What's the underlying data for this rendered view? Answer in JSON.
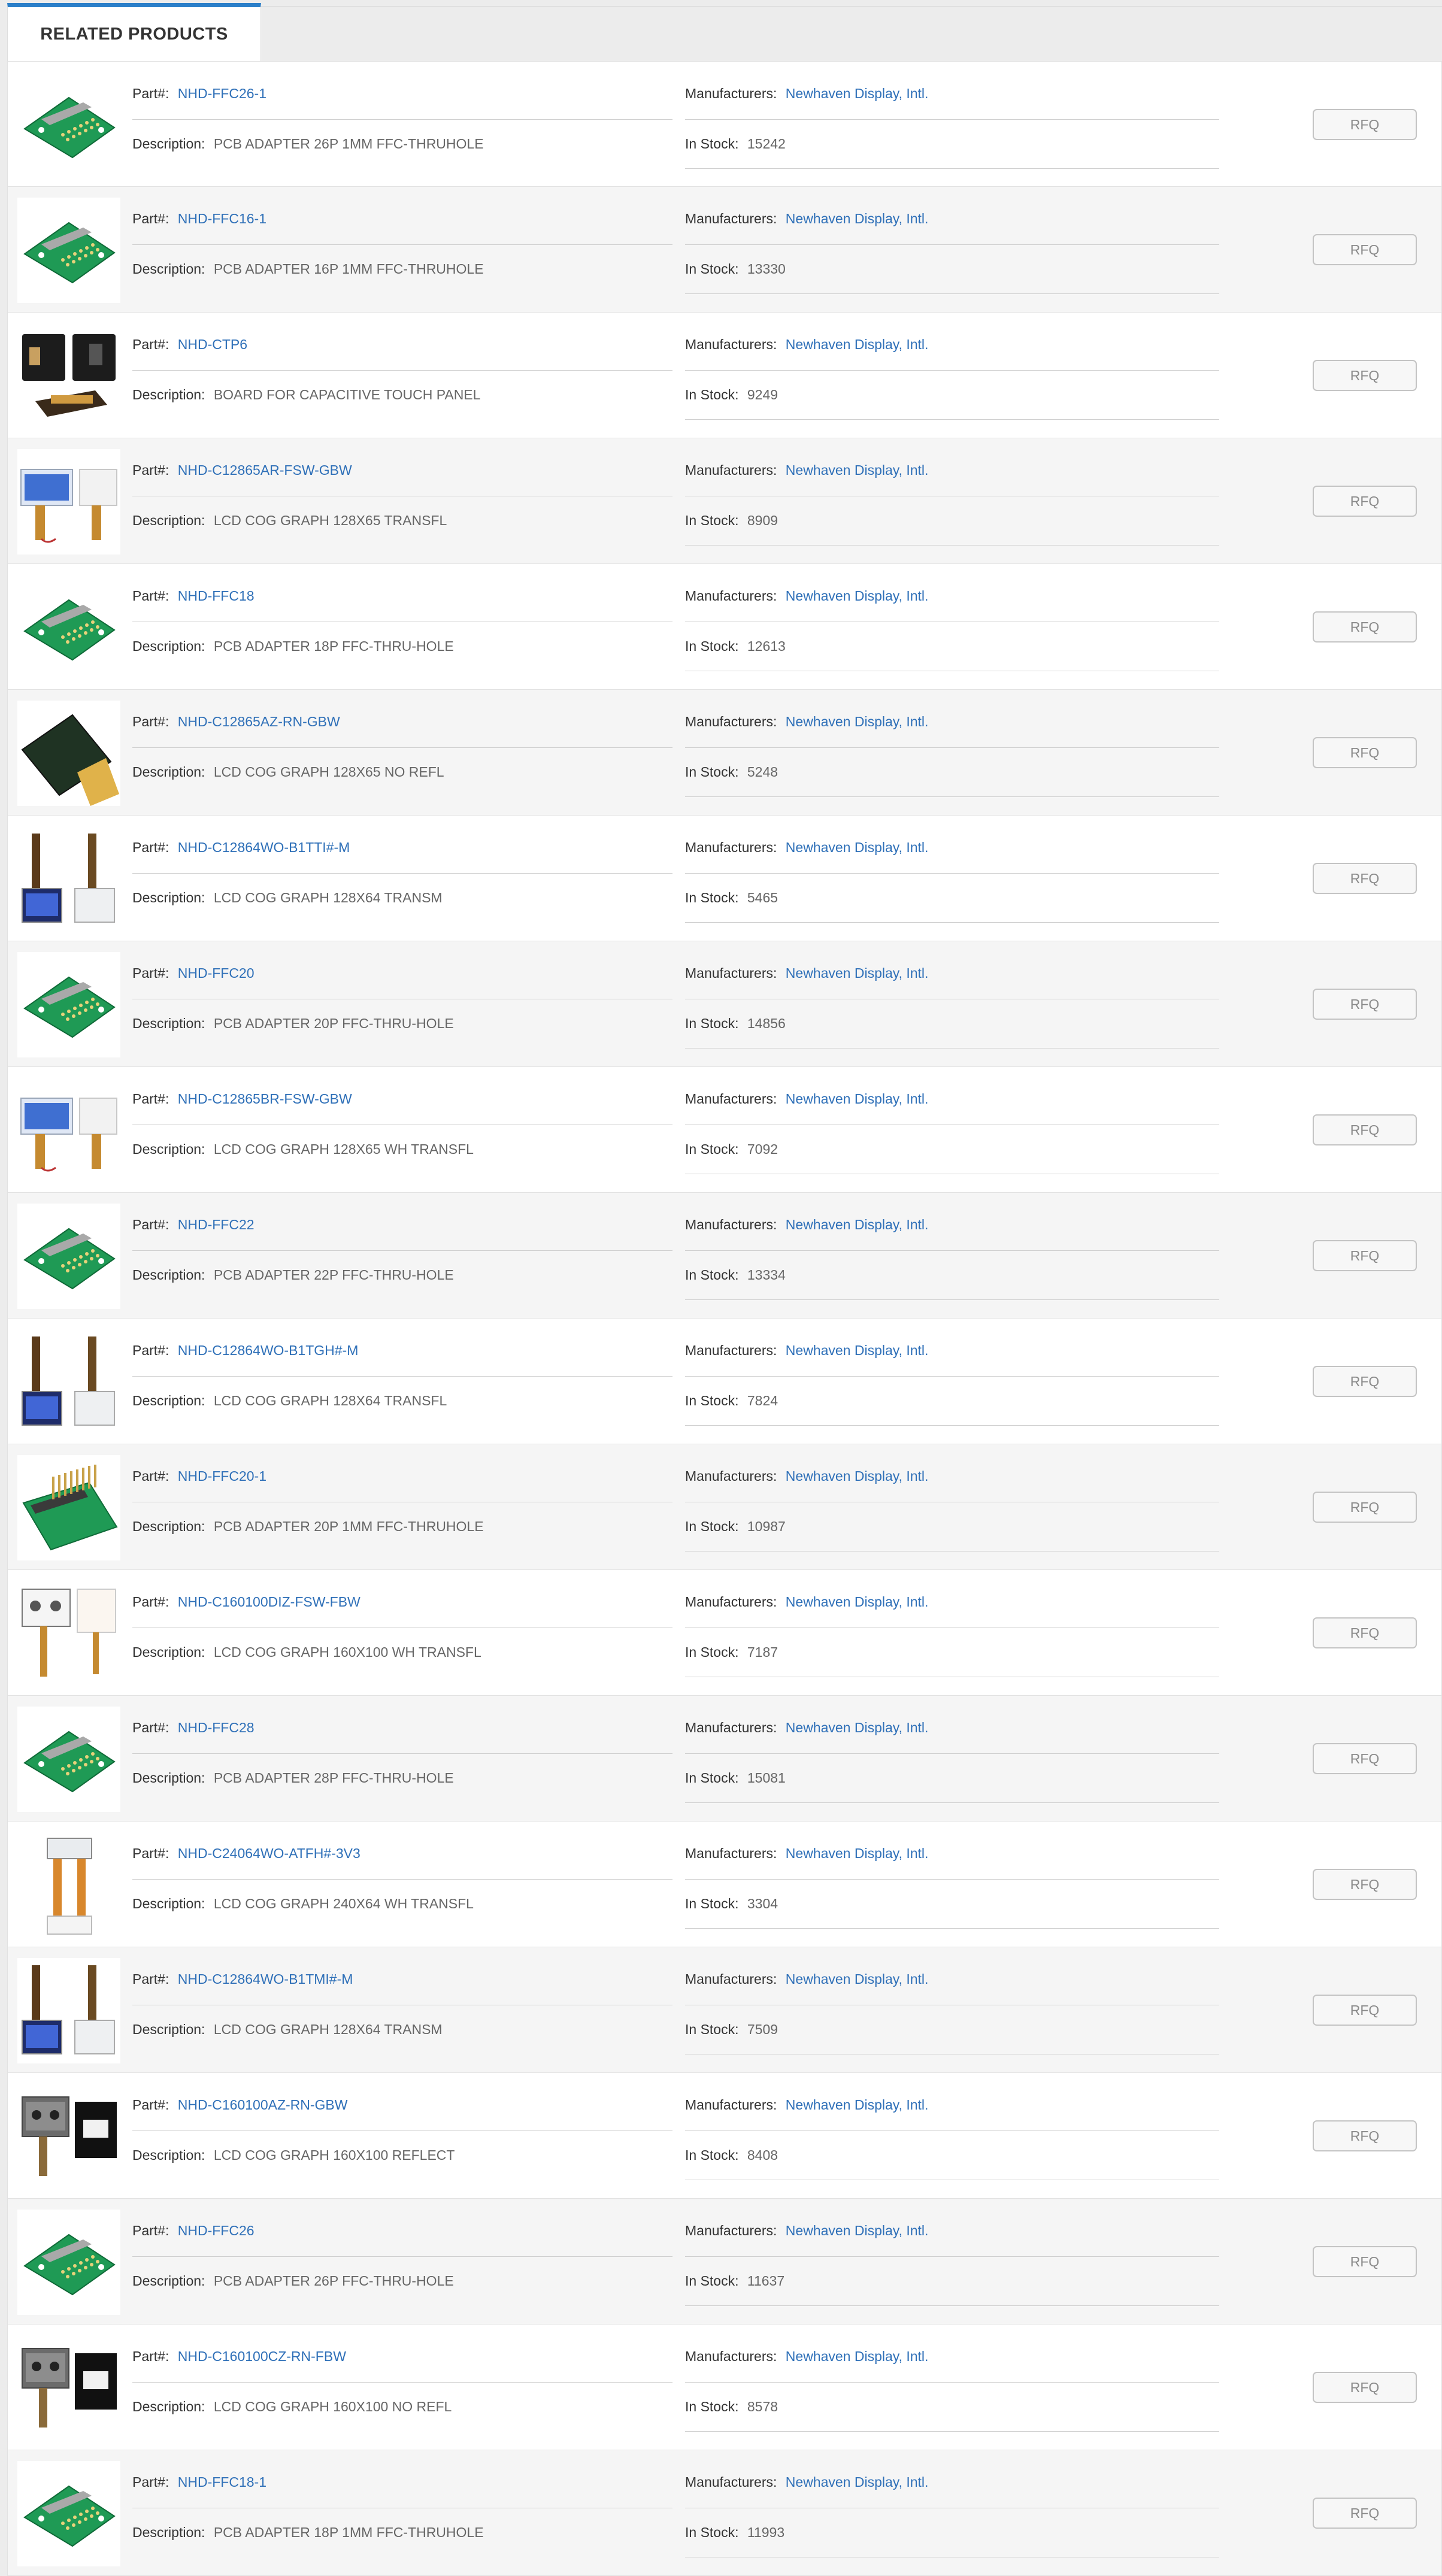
{
  "tab": {
    "label": "RELATED PRODUCTS"
  },
  "labels": {
    "part": "Part#:",
    "description": "Description:",
    "manufacturer": "Manufacturers:",
    "stock": "In Stock:",
    "rfq": "RFQ"
  },
  "colors": {
    "accent": "#2b7fc9",
    "link": "#2f70b8"
  },
  "products": [
    {
      "part": "NHD-FFC26-1",
      "description": "PCB ADAPTER 26P 1MM FFC-THRUHOLE",
      "manufacturer": "Newhaven Display, Intl.",
      "stock": "15242",
      "thumb": "pcb-board-icon"
    },
    {
      "part": "NHD-FFC16-1",
      "description": "PCB ADAPTER 16P 1MM FFC-THRUHOLE",
      "manufacturer": "Newhaven Display, Intl.",
      "stock": "13330",
      "thumb": "pcb-board-icon"
    },
    {
      "part": "NHD-CTP6",
      "description": "BOARD FOR CAPACITIVE TOUCH PANEL",
      "manufacturer": "Newhaven Display, Intl.",
      "stock": "9249",
      "thumb": "touch-board-icon"
    },
    {
      "part": "NHD-C12865AR-FSW-GBW",
      "description": "LCD COG GRAPH 128X65 TRANSFL",
      "manufacturer": "Newhaven Display, Intl.",
      "stock": "8909",
      "thumb": "lcd-blue-icon"
    },
    {
      "part": "NHD-FFC18",
      "description": "PCB ADAPTER 18P FFC-THRU-HOLE",
      "manufacturer": "Newhaven Display, Intl.",
      "stock": "12613",
      "thumb": "pcb-board-icon"
    },
    {
      "part": "NHD-C12865AZ-RN-GBW",
      "description": "LCD COG GRAPH 128X65 NO REFL",
      "manufacturer": "Newhaven Display, Intl.",
      "stock": "5248",
      "thumb": "lcd-dark-icon"
    },
    {
      "part": "NHD-C12864WO-B1TTI#-M",
      "description": "LCD COG GRAPH 128X64 TRANSM",
      "manufacturer": "Newhaven Display, Intl.",
      "stock": "5465",
      "thumb": "lcd-cable-icon"
    },
    {
      "part": "NHD-FFC20",
      "description": "PCB ADAPTER 20P FFC-THRU-HOLE",
      "manufacturer": "Newhaven Display, Intl.",
      "stock": "14856",
      "thumb": "pcb-board-icon"
    },
    {
      "part": "NHD-C12865BR-FSW-GBW",
      "description": "LCD COG GRAPH 128X65 WH TRANSFL",
      "manufacturer": "Newhaven Display, Intl.",
      "stock": "7092",
      "thumb": "lcd-blue-icon"
    },
    {
      "part": "NHD-FFC22",
      "description": "PCB ADAPTER 22P FFC-THRU-HOLE",
      "manufacturer": "Newhaven Display, Intl.",
      "stock": "13334",
      "thumb": "pcb-board-icon"
    },
    {
      "part": "NHD-C12864WO-B1TGH#-M",
      "description": "LCD COG GRAPH 128X64 TRANSFL",
      "manufacturer": "Newhaven Display, Intl.",
      "stock": "7824",
      "thumb": "lcd-cable-icon"
    },
    {
      "part": "NHD-FFC20-1",
      "description": "PCB ADAPTER 20P 1MM FFC-THRUHOLE",
      "manufacturer": "Newhaven Display, Intl.",
      "stock": "10987",
      "thumb": "pcb-header-icon"
    },
    {
      "part": "NHD-C160100DIZ-FSW-FBW",
      "description": "LCD COG GRAPH 160X100 WH TRANSFL",
      "manufacturer": "Newhaven Display, Intl.",
      "stock": "7187",
      "thumb": "lcd-white-icon"
    },
    {
      "part": "NHD-FFC28",
      "description": "PCB ADAPTER 28P FFC-THRU-HOLE",
      "manufacturer": "Newhaven Display, Intl.",
      "stock": "15081",
      "thumb": "pcb-board-icon"
    },
    {
      "part": "NHD-C24064WO-ATFH#-3V3",
      "description": "LCD COG GRAPH 240X64 WH TRANSFL",
      "manufacturer": "Newhaven Display, Intl.",
      "stock": "3304",
      "thumb": "lcd-strip-icon"
    },
    {
      "part": "NHD-C12864WO-B1TMI#-M",
      "description": "LCD COG GRAPH 128X64 TRANSM",
      "manufacturer": "Newhaven Display, Intl.",
      "stock": "7509",
      "thumb": "lcd-cable-icon"
    },
    {
      "part": "NHD-C160100AZ-RN-GBW",
      "description": "LCD COG GRAPH 160X100 REFLECT",
      "manufacturer": "Newhaven Display, Intl.",
      "stock": "8408",
      "thumb": "lcd-gray-icon"
    },
    {
      "part": "NHD-FFC26",
      "description": "PCB ADAPTER 26P FFC-THRU-HOLE",
      "manufacturer": "Newhaven Display, Intl.",
      "stock": "11637",
      "thumb": "pcb-board-icon"
    },
    {
      "part": "NHD-C160100CZ-RN-FBW",
      "description": "LCD COG GRAPH 160X100 NO REFL",
      "manufacturer": "Newhaven Display, Intl.",
      "stock": "8578",
      "thumb": "lcd-gray-icon"
    },
    {
      "part": "NHD-FFC18-1",
      "description": "PCB ADAPTER 18P 1MM FFC-THRUHOLE",
      "manufacturer": "Newhaven Display, Intl.",
      "stock": "11993",
      "thumb": "pcb-board-icon"
    }
  ]
}
